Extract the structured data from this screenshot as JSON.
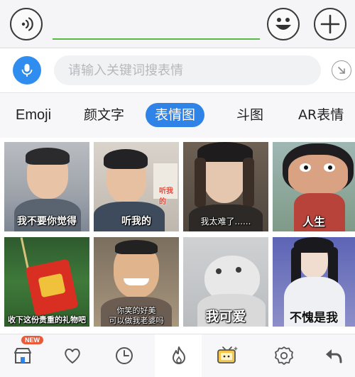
{
  "chatbar": {
    "voice_icon": "voice-wave-icon",
    "emoji_icon": "smiley-icon",
    "plus_icon": "plus-icon"
  },
  "search": {
    "mic_icon": "microphone-icon",
    "placeholder": "请输入关键词搜表情",
    "value": "",
    "collapse_icon": "collapse-arrow-icon"
  },
  "tabs": [
    {
      "label": "Emoji",
      "active": false
    },
    {
      "label": "颜文字",
      "active": false
    },
    {
      "label": "表情图",
      "active": true
    },
    {
      "label": "斗图",
      "active": false
    },
    {
      "label": "AR表情",
      "active": false
    }
  ],
  "stickers": [
    {
      "caption": "我不要你觉得"
    },
    {
      "caption": "听我的",
      "corner_text": "听我的"
    },
    {
      "caption": "我太难了......"
    },
    {
      "caption": "人生"
    },
    {
      "caption": "收下这份贵重的礼物吧"
    },
    {
      "caption_line1": "你笑的好美",
      "caption_line2": "可以做我老婆吗"
    },
    {
      "caption": "我可爱"
    },
    {
      "caption": "不愧是我"
    }
  ],
  "toolbar": {
    "new_badge": "NEW",
    "items": [
      "shop-icon",
      "heart-icon",
      "clock-icon",
      "flame-icon",
      "tv-sticker-icon",
      "gear-icon",
      "back-arrow-icon"
    ],
    "active": "flame-icon",
    "accent": "#2f82e6"
  }
}
